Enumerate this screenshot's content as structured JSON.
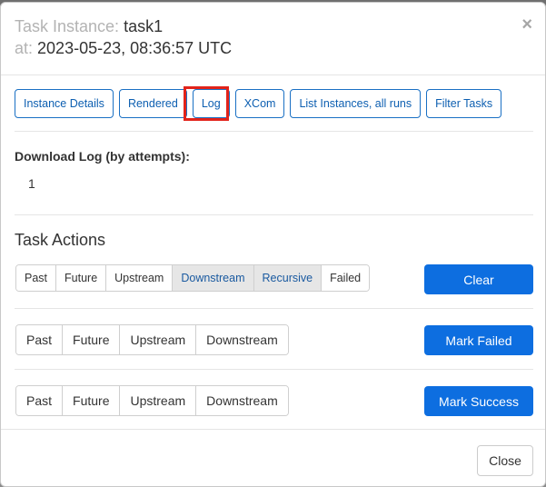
{
  "header": {
    "task_label": "Task Instance:",
    "task_name": "task1",
    "at_label": "at:",
    "timestamp": "2023-05-23, 08:36:57 UTC",
    "close_glyph": "×"
  },
  "nav_buttons": [
    "Instance Details",
    "Rendered",
    "Log",
    "XCom",
    "List Instances, all runs",
    "Filter Tasks"
  ],
  "download": {
    "title": "Download Log (by attempts):",
    "attempts": [
      "1"
    ]
  },
  "task_actions": {
    "title": "Task Actions",
    "clear": {
      "options": [
        "Past",
        "Future",
        "Upstream",
        "Downstream",
        "Recursive",
        "Failed"
      ],
      "active": [
        "Downstream",
        "Recursive"
      ],
      "button": "Clear"
    },
    "mark_failed": {
      "options": [
        "Past",
        "Future",
        "Upstream",
        "Downstream"
      ],
      "button": "Mark Failed"
    },
    "mark_success": {
      "options": [
        "Past",
        "Future",
        "Upstream",
        "Downstream"
      ],
      "button": "Mark Success"
    }
  },
  "footer": {
    "close_label": "Close"
  },
  "colors": {
    "primary": "#0d6ee0",
    "outline": "#1a70c4",
    "highlight": "#e2231a"
  }
}
